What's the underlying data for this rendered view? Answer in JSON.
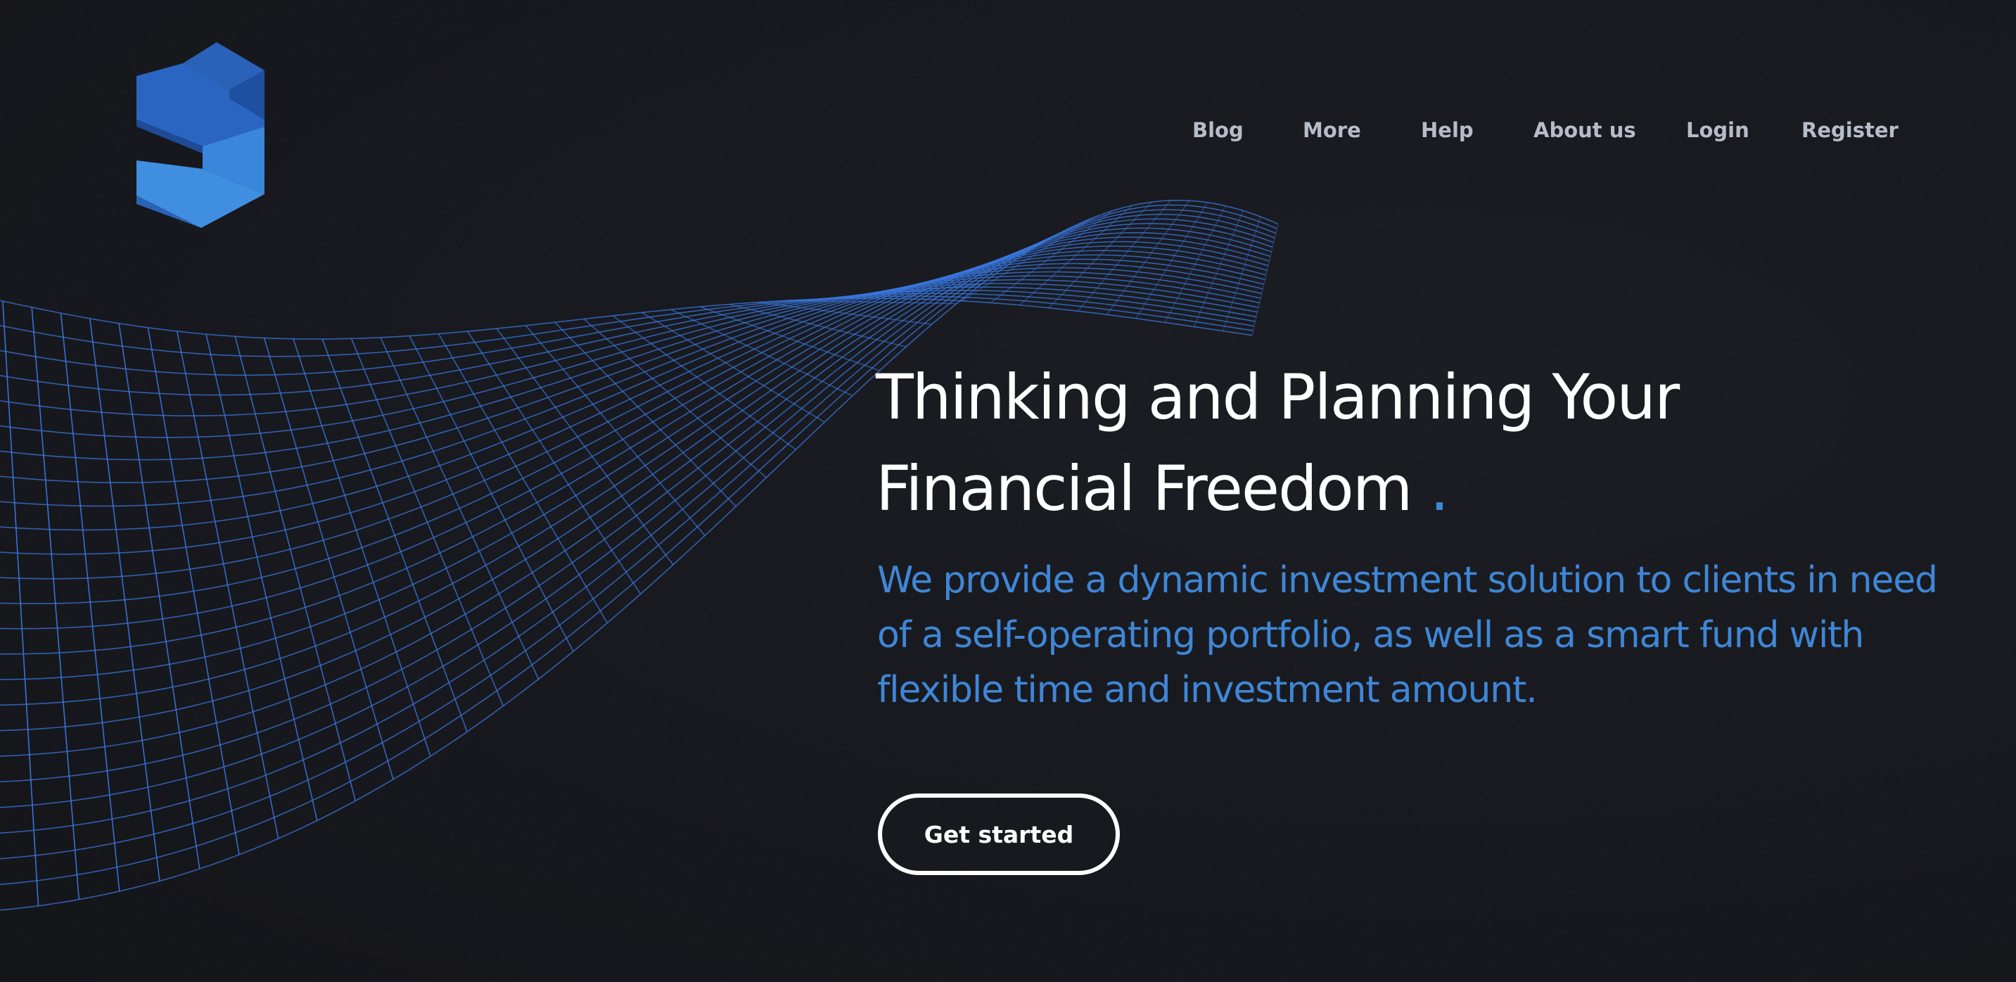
{
  "brand": {
    "logo_icon": "s-cube-logo",
    "colors": {
      "background": "#18191e",
      "accent": "#3f86d6",
      "wave": "#3a78e0",
      "logo_light": "#3f8ee0",
      "logo_dark": "#1f4fa0",
      "nav_text": "#b6bdc8",
      "heading": "#ffffff"
    }
  },
  "nav": {
    "items": [
      {
        "label": "Blog"
      },
      {
        "label": "More"
      },
      {
        "label": "Help"
      },
      {
        "label": "About us"
      },
      {
        "label": "Login"
      },
      {
        "label": "Register"
      }
    ]
  },
  "hero": {
    "headline_line1": "Thinking and Planning Your",
    "headline_line2": "Financial Freedom",
    "headline_dot": ".",
    "subtext": "We provide a dynamic investment solution to clients in need of a self-operating portfolio, as well as a smart fund with flexible time and investment amount.",
    "cta_label": "Get started",
    "background_graphic": "wireframe-wave-mesh"
  }
}
